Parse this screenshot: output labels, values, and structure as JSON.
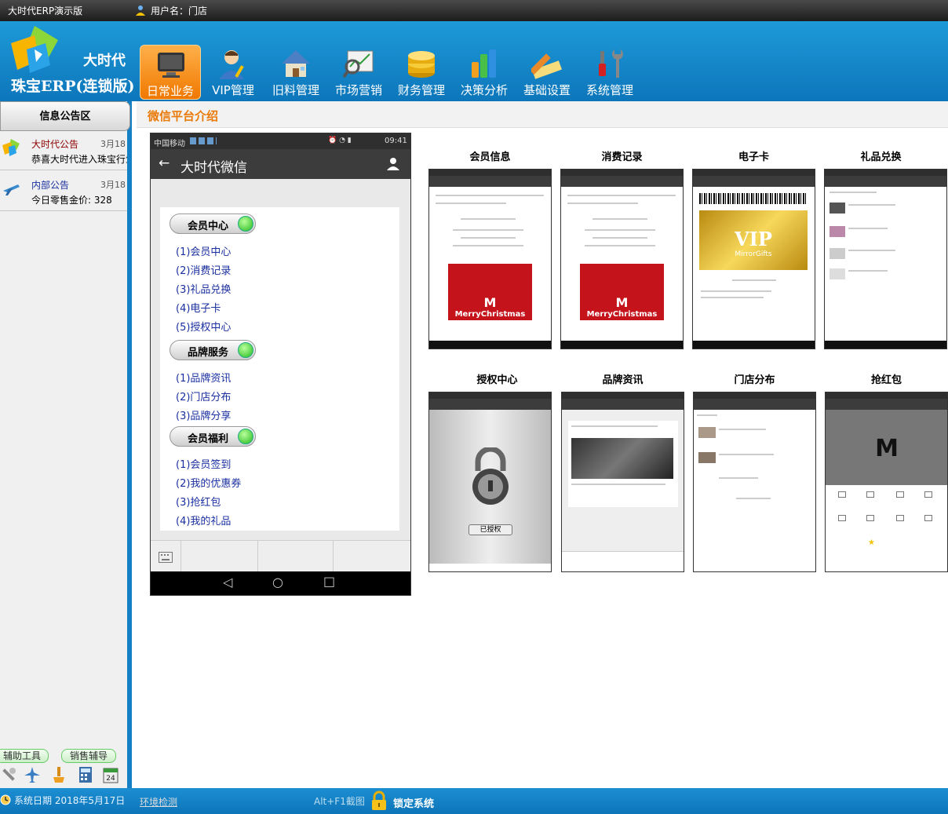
{
  "window": {
    "title": "大时代ERP演示版",
    "user_label": "用户名：门店"
  },
  "brand": {
    "line1": "大时代",
    "line2": "珠宝ERP(连锁版)"
  },
  "nav": [
    {
      "label": "日常业务",
      "active": true,
      "icon": "monitor-icon"
    },
    {
      "label": "VIP管理",
      "active": false,
      "icon": "user-icon"
    },
    {
      "label": "旧料管理",
      "active": false,
      "icon": "house-icon"
    },
    {
      "label": "市场营销",
      "active": false,
      "icon": "magnifier-chart-icon"
    },
    {
      "label": "财务管理",
      "active": false,
      "icon": "coins-icon"
    },
    {
      "label": "决策分析",
      "active": false,
      "icon": "bar-chart-icon"
    },
    {
      "label": "基础设置",
      "active": false,
      "icon": "pencil-ruler-icon"
    },
    {
      "label": "系统管理",
      "active": false,
      "icon": "tools-icon"
    }
  ],
  "sidebar": {
    "title": "信息公告区",
    "notices": [
      {
        "title": "大时代公告",
        "date": "3月18",
        "body": "恭喜大时代进入珠宝行业",
        "color": "#8b0000"
      },
      {
        "title": "内部公告",
        "date": "3月18",
        "body": "今日零售金价:   328",
        "color": "#1a2fa0"
      }
    ],
    "tools": [
      {
        "label": "辅助工具"
      },
      {
        "label": "销售辅导"
      }
    ]
  },
  "content": {
    "title": "微信平台介绍",
    "phone": {
      "carrier": "中国移动",
      "time": "09:41",
      "app_title": "大时代微信",
      "groups": [
        {
          "name": "会员中心",
          "items": [
            "(1)会员中心",
            "(2)消费记录",
            "(3)礼品兑换",
            "(4)电子卡",
            "(5)授权中心"
          ]
        },
        {
          "name": "品牌服务",
          "items": [
            "(1)品牌资讯",
            "(2)门店分布",
            "(3)品牌分享"
          ]
        },
        {
          "name": "会员福利",
          "items": [
            "(1)会员签到",
            "(2)我的优惠券",
            "(3)抢红包",
            "(4)我的礼品"
          ]
        }
      ]
    },
    "screens": [
      {
        "label": "会员信息"
      },
      {
        "label": "消费记录"
      },
      {
        "label": "电子卡"
      },
      {
        "label": "礼品兑换"
      },
      {
        "label": "授权中心"
      },
      {
        "label": "品牌资讯"
      },
      {
        "label": "门店分布"
      },
      {
        "label": "抢红包"
      }
    ],
    "xmas_text": "MerryChristmas",
    "vip_text": "VIP",
    "vip_sub": "MirrorGifts",
    "lock_button": "已授权"
  },
  "status": {
    "date": "系统日期 2018年5月17日",
    "env": "环境检测",
    "shortcut": "Alt+F1截图",
    "lock": "锁定系统"
  },
  "colors": {
    "accent": "#e97a0a",
    "header": "#1580c4",
    "nav_active": "#f49a22"
  }
}
